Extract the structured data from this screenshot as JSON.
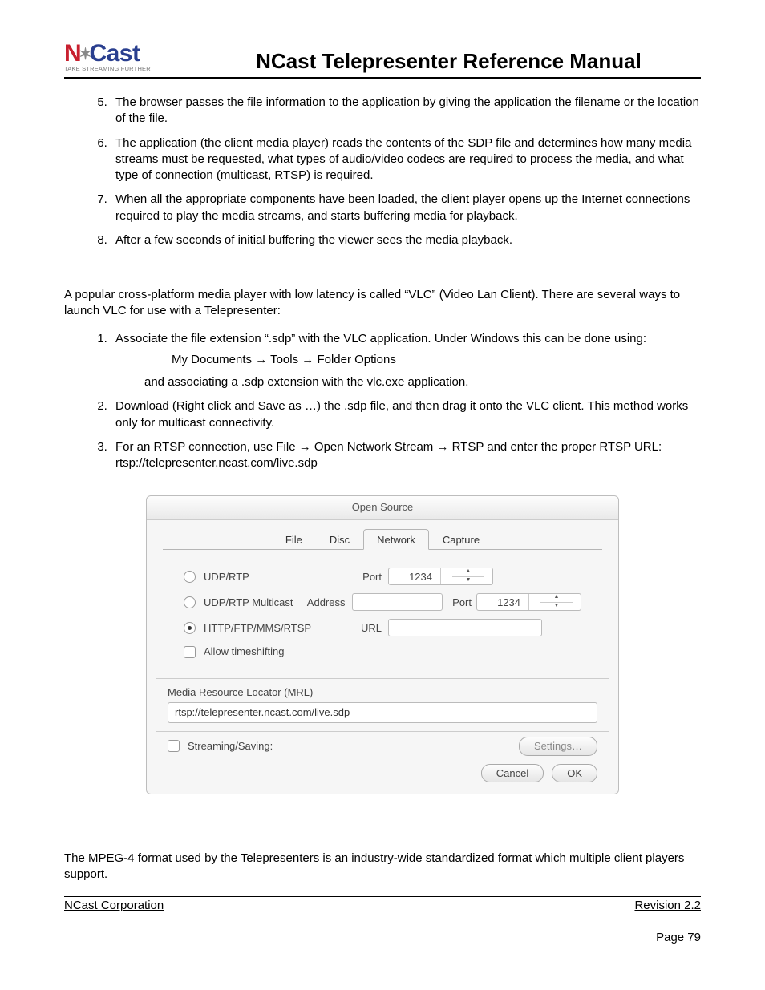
{
  "logo": {
    "n": "N",
    "cast": "Cast",
    "tag": "TAKE STREAMING FURTHER"
  },
  "title": "NCast Telepresenter Reference Manual",
  "listA_start": 5,
  "listA": [
    "The browser passes the file information to the application by giving the application the filename or the location of the file.",
    "The application (the client media player) reads the contents of the SDP file and determines how many media streams must be requested, what types of audio/video codecs are required to process the media, and what type of connection (multicast, RTSP) is required.",
    "When all the appropriate components have been loaded, the client player opens up the Internet connections required to play the media streams, and starts buffering media for playback.",
    "After a few seconds of initial buffering the viewer sees the media playback."
  ],
  "para1": "A popular cross-platform media player with low latency is called “VLC” (Video Lan Client). There are several ways to launch VLC for use with a Telepresenter:",
  "listB_start": 1,
  "listB": {
    "b1": "Associate the file extension “.sdp” with the VLC application. Under Windows this can be done using:",
    "b1_sub": "My Documents → Tools → Folder Options",
    "b1_sub2": "and associating a .sdp extension with the vlc.exe application.",
    "b2": "Download (Right click and Save as …) the .sdp file, and then drag it onto the VLC client. This method works only for multicast connectivity.",
    "b3": "For an RTSP connection, use File → Open Network Stream → RTSP and enter the proper RTSP URL: rtsp://telepresenter.ncast.com/live.sdp"
  },
  "dialog": {
    "title": "Open Source",
    "tabs": [
      "File",
      "Disc",
      "Network",
      "Capture"
    ],
    "active_tab": 2,
    "radio1": "UDP/RTP",
    "radio2": "UDP/RTP Multicast",
    "radio3": "HTTP/FTP/MMS/RTSP",
    "port_label": "Port",
    "port1": "1234",
    "addr_label": "Address",
    "port2": "1234",
    "url_label": "URL",
    "timeshift": "Allow timeshifting",
    "mrl_label": "Media Resource Locator (MRL)",
    "mrl_value": "rtsp://telepresenter.ncast.com/live.sdp",
    "streaming": "Streaming/Saving:",
    "settings": "Settings…",
    "cancel": "Cancel",
    "ok": "OK"
  },
  "para2": "The MPEG-4 format used by the Telepresenters is an industry-wide standardized format which multiple client players support.",
  "footer": {
    "left": "NCast Corporation",
    "right": "Revision 2.2"
  },
  "page": "Page 79"
}
